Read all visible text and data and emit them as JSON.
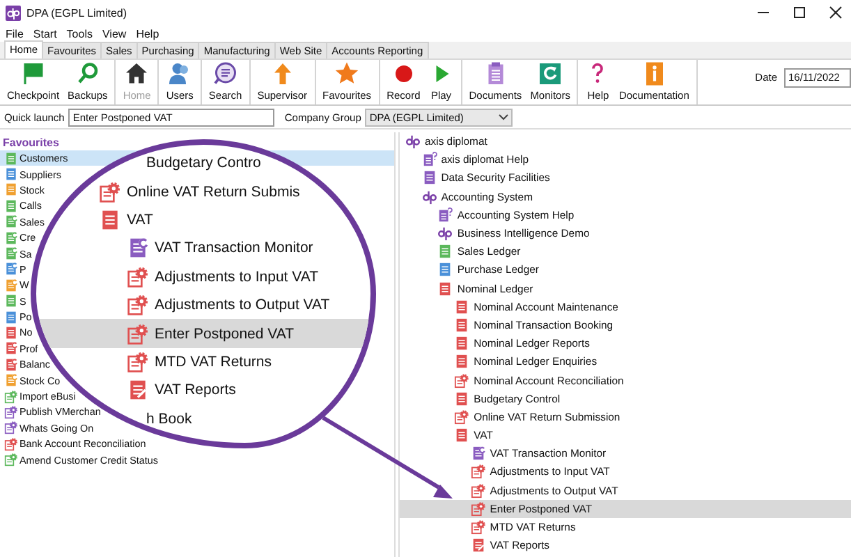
{
  "window": {
    "title": "DPA (EGPL Limited)"
  },
  "menu": [
    "File",
    "Start",
    "Tools",
    "View",
    "Help"
  ],
  "tabs": [
    {
      "label": "Home",
      "selected": true
    },
    {
      "label": "Favourites",
      "selected": false
    },
    {
      "label": "Sales",
      "selected": false
    },
    {
      "label": "Purchasing",
      "selected": false
    },
    {
      "label": "Manufacturing",
      "selected": false
    },
    {
      "label": "Web Site",
      "selected": false
    },
    {
      "label": "Accounts Reporting",
      "selected": false
    }
  ],
  "toolbar": [
    {
      "label": "Checkpoint",
      "kind": "flag",
      "disabled": false,
      "separator_after": false
    },
    {
      "label": "Backups",
      "kind": "loop",
      "disabled": false,
      "separator_after": true
    },
    {
      "label": "Home",
      "kind": "house",
      "disabled": true,
      "separator_after": true
    },
    {
      "label": "Users",
      "kind": "user",
      "disabled": false,
      "separator_after": true
    },
    {
      "label": "Search",
      "kind": "search",
      "disabled": false,
      "separator_after": true
    },
    {
      "label": "Supervisor",
      "kind": "up",
      "disabled": false,
      "separator_after": true
    },
    {
      "label": "Favourites",
      "kind": "star",
      "disabled": false,
      "separator_after": true
    },
    {
      "label": "Record",
      "kind": "record",
      "disabled": false,
      "separator_after": false
    },
    {
      "label": "Play",
      "kind": "play",
      "disabled": false,
      "separator_after": true
    },
    {
      "label": "Documents",
      "kind": "clipboard",
      "disabled": false,
      "separator_after": false
    },
    {
      "label": "Monitors",
      "kind": "monitor",
      "disabled": false,
      "separator_after": true
    },
    {
      "label": "Help",
      "kind": "question",
      "disabled": false,
      "separator_after": false
    },
    {
      "label": "Documentation",
      "kind": "info",
      "disabled": false,
      "separator_after": true
    }
  ],
  "date": {
    "label": "Date",
    "value": "16/11/2022"
  },
  "quick_launch": {
    "label": "Quick launch",
    "value": "Enter Postponed VAT"
  },
  "company_group": {
    "label": "Company Group",
    "value": "DPA (EGPL Limited)"
  },
  "favourites": {
    "title": "Favourites",
    "items": [
      {
        "label": "Customers",
        "kind": "doc",
        "color": "#5cb85c",
        "selected": true
      },
      {
        "label": "Suppliers",
        "kind": "doc",
        "color": "#4a90d9",
        "selected": false
      },
      {
        "label": "Stock",
        "kind": "doc",
        "color": "#f0a030",
        "selected": false
      },
      {
        "label": "Calls",
        "kind": "doc",
        "color": "#5cb85c",
        "selected": false
      },
      {
        "label": "Sales",
        "kind": "monitor",
        "color": "#5cb85c",
        "selected": false
      },
      {
        "label": "Cre",
        "kind": "monitor",
        "color": "#5cb85c",
        "selected": false
      },
      {
        "label": "Sa",
        "kind": "monitor",
        "color": "#5cb85c",
        "selected": false
      },
      {
        "label": "P",
        "kind": "monitor",
        "color": "#4a90d9",
        "selected": false
      },
      {
        "label": "W",
        "kind": "monitor",
        "color": "#f0a030",
        "selected": false
      },
      {
        "label": "S",
        "kind": "doc",
        "color": "#5cb85c",
        "selected": false
      },
      {
        "label": "Po",
        "kind": "doc",
        "color": "#4a90d9",
        "selected": false
      },
      {
        "label": "No",
        "kind": "doc",
        "color": "#e05050",
        "selected": false
      },
      {
        "label": "Prof",
        "kind": "monitor",
        "color": "#e05050",
        "selected": false
      },
      {
        "label": "Balanc",
        "kind": "monitor",
        "color": "#e05050",
        "selected": false
      },
      {
        "label": "Stock Co",
        "kind": "monitor",
        "color": "#f0a030",
        "selected": false
      },
      {
        "label": "Import eBusi",
        "kind": "gear",
        "color": "#5cb85c",
        "selected": false
      },
      {
        "label": "Publish VMerchan",
        "kind": "gear",
        "color": "#8a5cc0",
        "selected": false
      },
      {
        "label": "Whats Going On",
        "kind": "gear",
        "color": "#8a5cc0",
        "selected": false
      },
      {
        "label": "Bank Account Reconciliation",
        "kind": "gear",
        "color": "#e05050",
        "selected": false
      },
      {
        "label": "Amend Customer Credit Status",
        "kind": "gear",
        "color": "#5cb85c",
        "selected": false
      }
    ]
  },
  "tree": [
    {
      "label": "axis diplomat",
      "kind": "dp",
      "color": "#7a3fa8",
      "selected": false,
      "children": [
        {
          "label": "axis diplomat Help",
          "kind": "help",
          "color": "#8a5cc0",
          "selected": false
        },
        {
          "label": "Data Security Facilities",
          "kind": "doc",
          "color": "#8a5cc0",
          "selected": false
        },
        {
          "label": "Accounting System",
          "kind": "dp",
          "color": "#7a3fa8",
          "selected": false,
          "children": [
            {
              "label": "Accounting System Help",
              "kind": "help",
              "color": "#8a5cc0",
              "selected": false
            },
            {
              "label": "Business Intelligence Demo",
              "kind": "dp",
              "color": "#7a3fa8",
              "selected": false
            },
            {
              "label": "Sales Ledger",
              "kind": "doc",
              "color": "#5cb85c",
              "selected": false
            },
            {
              "label": "Purchase Ledger",
              "kind": "doc",
              "color": "#4a90d9",
              "selected": false
            },
            {
              "label": "Nominal Ledger",
              "kind": "doc",
              "color": "#e05050",
              "selected": false,
              "children": [
                {
                  "label": "Nominal Account Maintenance",
                  "kind": "doc",
                  "color": "#e05050",
                  "selected": false
                },
                {
                  "label": "Nominal Transaction Booking",
                  "kind": "doc",
                  "color": "#e05050",
                  "selected": false
                },
                {
                  "label": "Nominal Ledger Reports",
                  "kind": "doc",
                  "color": "#e05050",
                  "selected": false
                },
                {
                  "label": "Nominal Ledger Enquiries",
                  "kind": "doc",
                  "color": "#e05050",
                  "selected": false
                },
                {
                  "label": "Nominal Account Reconciliation",
                  "kind": "gear",
                  "color": "#e05050",
                  "selected": false
                },
                {
                  "label": "Budgetary Control",
                  "kind": "doc",
                  "color": "#e05050",
                  "selected": false
                },
                {
                  "label": "Online VAT Return Submission",
                  "kind": "gear",
                  "color": "#e05050",
                  "selected": false
                },
                {
                  "label": "VAT",
                  "kind": "doc",
                  "color": "#e05050",
                  "selected": false,
                  "children": [
                    {
                      "label": "VAT Transaction Monitor",
                      "kind": "monitor",
                      "color": "#8a5cc0",
                      "selected": false
                    },
                    {
                      "label": "Adjustments to Input VAT",
                      "kind": "gear",
                      "color": "#e05050",
                      "selected": false
                    },
                    {
                      "label": "Adjustments to Output VAT",
                      "kind": "gear",
                      "color": "#e05050",
                      "selected": false
                    },
                    {
                      "label": "Enter Postponed VAT",
                      "kind": "gear",
                      "color": "#e05050",
                      "selected": true
                    },
                    {
                      "label": "MTD VAT Returns",
                      "kind": "gear",
                      "color": "#e05050",
                      "selected": false
                    },
                    {
                      "label": "VAT Reports",
                      "kind": "report",
                      "color": "#e05050",
                      "selected": false
                    }
                  ]
                }
              ]
            }
          ]
        }
      ]
    }
  ],
  "magnifier": {
    "items": [
      {
        "label": "Budgetary Contro",
        "kind": "none",
        "selected": false
      },
      {
        "label": "Online VAT Return Submis",
        "kind": "gear",
        "color": "#e05050",
        "selected": false
      },
      {
        "label": "VAT",
        "kind": "doc",
        "color": "#e05050",
        "selected": false,
        "children": [
          {
            "label": "VAT Transaction Monitor",
            "kind": "monitor",
            "color": "#8a5cc0",
            "selected": false
          },
          {
            "label": "Adjustments to Input VAT",
            "kind": "gear",
            "color": "#e05050",
            "selected": false
          },
          {
            "label": "Adjustments to Output VAT",
            "kind": "gear",
            "color": "#e05050",
            "selected": false
          },
          {
            "label": "Enter Postponed VAT",
            "kind": "gear",
            "color": "#e05050",
            "selected": true
          },
          {
            "label": "MTD VAT Returns",
            "kind": "gear",
            "color": "#e05050",
            "selected": false
          },
          {
            "label": "VAT Reports",
            "kind": "report",
            "color": "#e05050",
            "selected": false
          }
        ]
      },
      {
        "label": "h Book",
        "kind": "none",
        "selected": false
      }
    ]
  }
}
